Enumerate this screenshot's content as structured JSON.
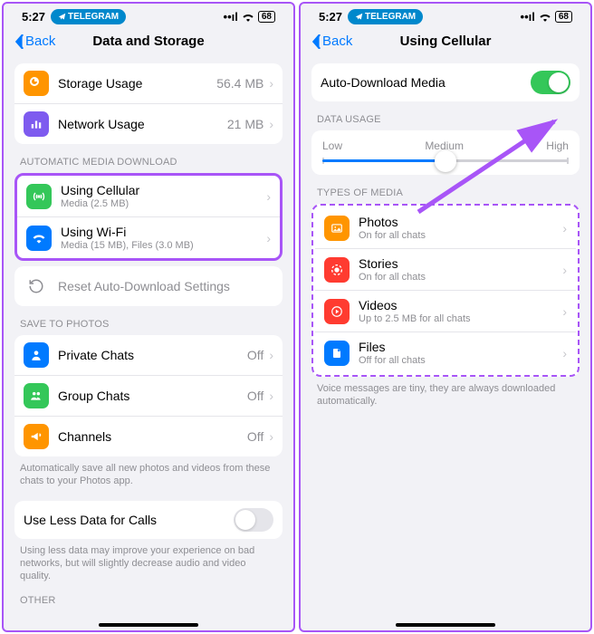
{
  "status": {
    "time": "5:27",
    "app_pill": "TELEGRAM",
    "battery": "68"
  },
  "left": {
    "back": "Back",
    "title": "Data and Storage",
    "storage": {
      "label": "Storage Usage",
      "value": "56.4 MB"
    },
    "network": {
      "label": "Network Usage",
      "value": "21 MB"
    },
    "auto_header": "AUTOMATIC MEDIA DOWNLOAD",
    "cellular": {
      "label": "Using Cellular",
      "sub": "Media (2.5 MB)"
    },
    "wifi": {
      "label": "Using Wi-Fi",
      "sub": "Media (15 MB), Files (3.0 MB)"
    },
    "reset": "Reset Auto-Download Settings",
    "save_header": "SAVE TO PHOTOS",
    "private": {
      "label": "Private Chats",
      "value": "Off"
    },
    "group": {
      "label": "Group Chats",
      "value": "Off"
    },
    "channels": {
      "label": "Channels",
      "value": "Off"
    },
    "save_footer": "Automatically save all new photos and videos from these chats to your Photos app.",
    "less_data": "Use Less Data for Calls",
    "less_data_footer": "Using less data may improve your experience on bad networks, but will slightly decrease audio and video quality.",
    "other_header": "OTHER"
  },
  "right": {
    "back": "Back",
    "title": "Using Cellular",
    "auto_download": "Auto-Download Media",
    "data_usage_header": "DATA USAGE",
    "slider": {
      "low": "Low",
      "medium": "Medium",
      "high": "High",
      "position": 50
    },
    "types_header": "TYPES OF MEDIA",
    "photos": {
      "label": "Photos",
      "sub": "On for all chats"
    },
    "stories": {
      "label": "Stories",
      "sub": "On for all chats"
    },
    "videos": {
      "label": "Videos",
      "sub": "Up to 2.5 MB for all chats"
    },
    "files": {
      "label": "Files",
      "sub": "Off for all chats"
    },
    "types_footer": "Voice messages are tiny, they are always downloaded automatically."
  },
  "colors": {
    "orange": "#ff9500",
    "purple": "#7e5bef",
    "green": "#34c759",
    "blue": "#007aff",
    "red": "#ff3b30",
    "grey": "#8e8e93"
  }
}
